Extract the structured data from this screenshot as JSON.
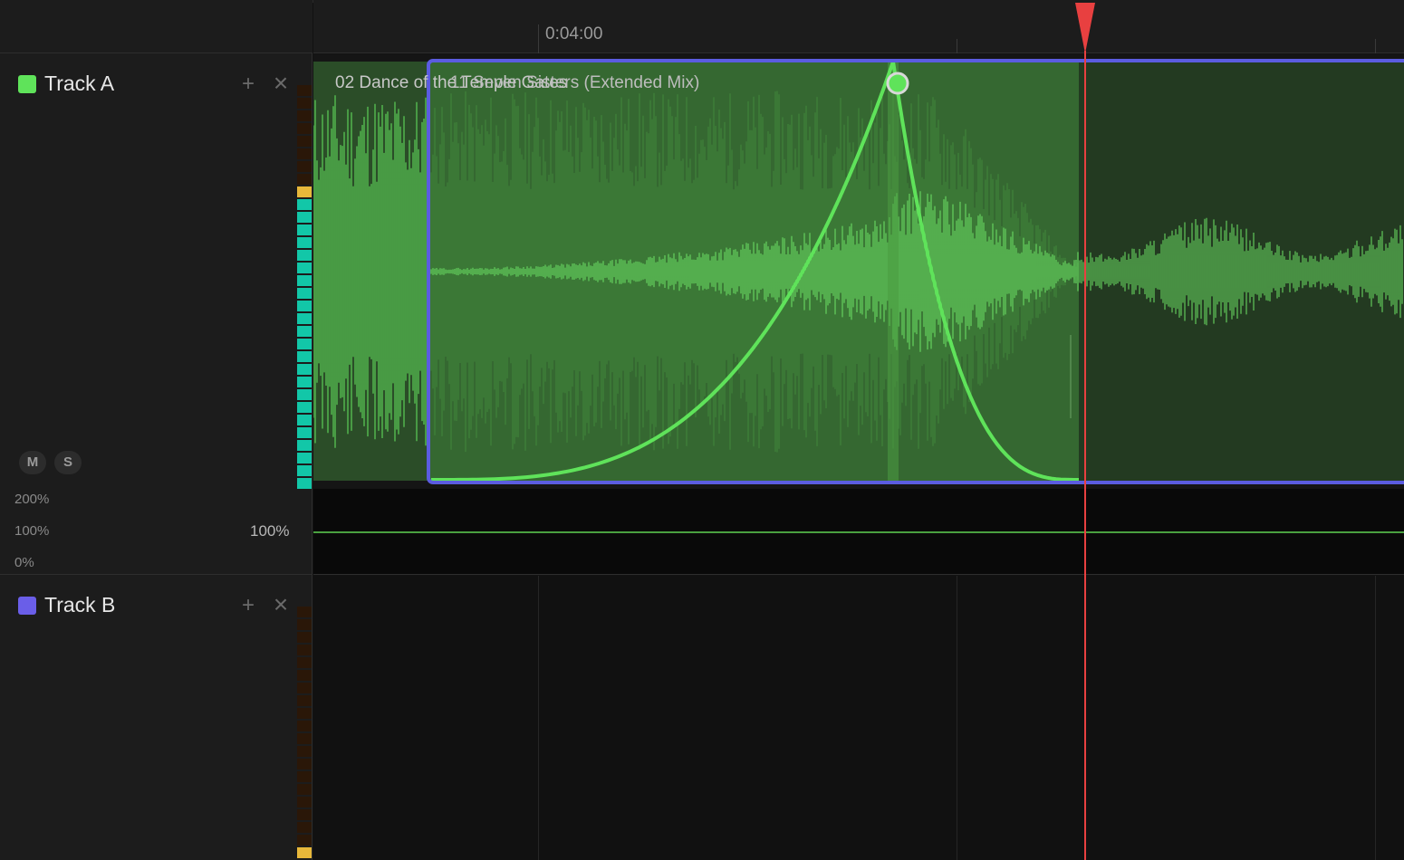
{
  "ruler": {
    "time_label": "0:04:00"
  },
  "tracks": [
    {
      "name": "Track A",
      "color": "#5fe35a",
      "add_icon": "+",
      "remove_icon": "×"
    },
    {
      "name": "Track B",
      "color": "#6a5ee8",
      "add_icon": "+",
      "remove_icon": "×"
    }
  ],
  "track_a_controls": {
    "mute_label": "M",
    "solo_label": "S"
  },
  "volume": {
    "max_label": "200%",
    "mid_label": "100%",
    "min_label": "0%",
    "current_label": "100%"
  },
  "clips": {
    "back_clip_title": "02 Dance of the Temple Gates",
    "front_clip_title": "11 Seven Sisters (Extended Mix)"
  },
  "colors": {
    "accent_selection": "#5b5ce0",
    "playhead": "#e84040",
    "waveform": "#5fd85a",
    "meter_on": "#12c7a8",
    "meter_peak": "#e8b83a"
  },
  "meter_level": 0.73
}
